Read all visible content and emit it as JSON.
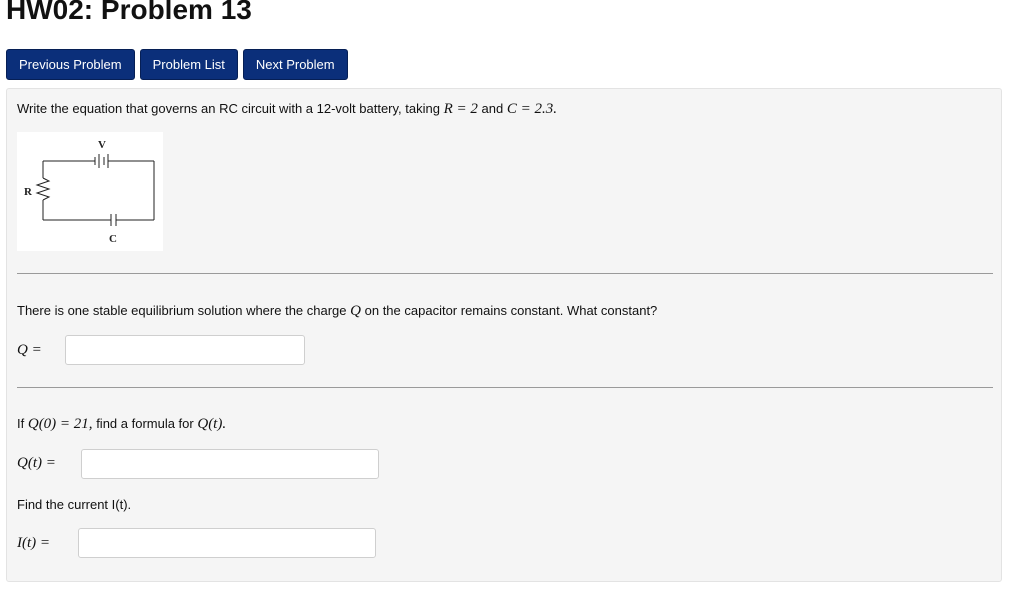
{
  "page": {
    "title": "HW02: Problem 13"
  },
  "nav": {
    "previous_label": "Previous Problem",
    "list_label": "Problem List",
    "next_label": "Next Problem"
  },
  "problem": {
    "intro_text": "Write the equation that governs an RC circuit with a 12-volt battery, taking",
    "intro_r": "R = 2",
    "intro_and": "and",
    "intro_c": "C = 2.3.",
    "diagram": {
      "v_label": "V",
      "r_label": "R",
      "c_label": "C"
    },
    "part1_text": "There is one stable equilibrium solution where the charge",
    "part1_q": "Q",
    "part1_text_after": "on the capacitor remains constant. What constant?",
    "part1_answer_label": "Q =",
    "part1_answer_value": "",
    "part2_if": "If",
    "part2_condition": "Q(0) = 21,",
    "part2_text": "find a formula for",
    "part2_target": "Q(t).",
    "part2_answer_label": "Q(t) =",
    "part2_answer_value": "",
    "part3_text": "Find the current I(t).",
    "part3_answer_label": "I(t) =",
    "part3_answer_value": ""
  },
  "colors": {
    "button_bg": "#0b2f7a",
    "panel_bg": "#f5f5f5"
  }
}
